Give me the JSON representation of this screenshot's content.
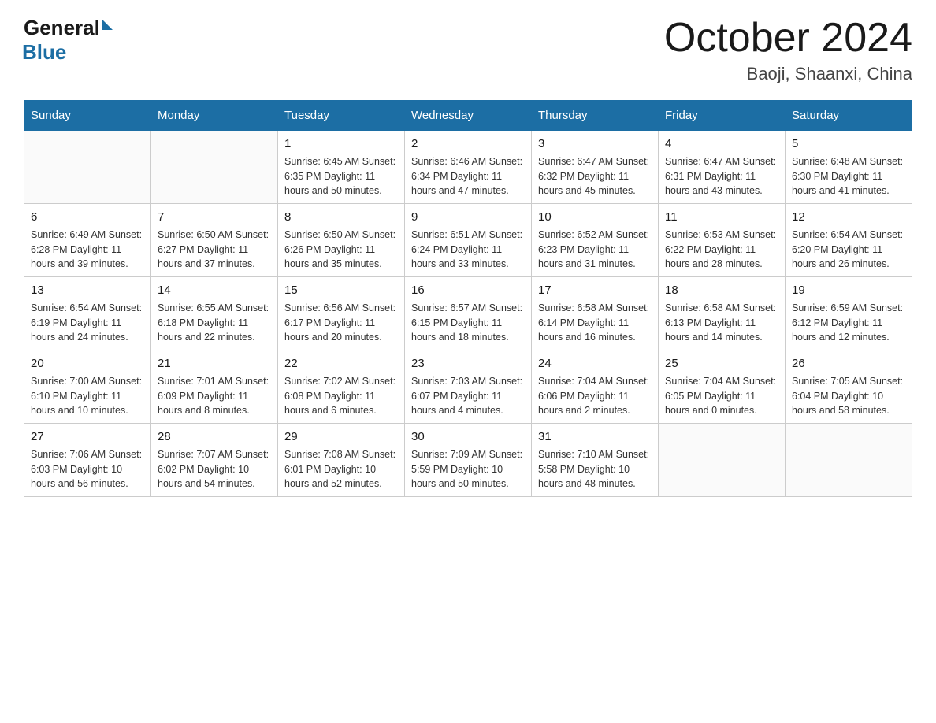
{
  "logo": {
    "general": "General",
    "blue": "Blue"
  },
  "title": "October 2024",
  "location": "Baoji, Shaanxi, China",
  "days_of_week": [
    "Sunday",
    "Monday",
    "Tuesday",
    "Wednesday",
    "Thursday",
    "Friday",
    "Saturday"
  ],
  "weeks": [
    [
      {
        "day": "",
        "info": ""
      },
      {
        "day": "",
        "info": ""
      },
      {
        "day": "1",
        "info": "Sunrise: 6:45 AM\nSunset: 6:35 PM\nDaylight: 11 hours\nand 50 minutes."
      },
      {
        "day": "2",
        "info": "Sunrise: 6:46 AM\nSunset: 6:34 PM\nDaylight: 11 hours\nand 47 minutes."
      },
      {
        "day": "3",
        "info": "Sunrise: 6:47 AM\nSunset: 6:32 PM\nDaylight: 11 hours\nand 45 minutes."
      },
      {
        "day": "4",
        "info": "Sunrise: 6:47 AM\nSunset: 6:31 PM\nDaylight: 11 hours\nand 43 minutes."
      },
      {
        "day": "5",
        "info": "Sunrise: 6:48 AM\nSunset: 6:30 PM\nDaylight: 11 hours\nand 41 minutes."
      }
    ],
    [
      {
        "day": "6",
        "info": "Sunrise: 6:49 AM\nSunset: 6:28 PM\nDaylight: 11 hours\nand 39 minutes."
      },
      {
        "day": "7",
        "info": "Sunrise: 6:50 AM\nSunset: 6:27 PM\nDaylight: 11 hours\nand 37 minutes."
      },
      {
        "day": "8",
        "info": "Sunrise: 6:50 AM\nSunset: 6:26 PM\nDaylight: 11 hours\nand 35 minutes."
      },
      {
        "day": "9",
        "info": "Sunrise: 6:51 AM\nSunset: 6:24 PM\nDaylight: 11 hours\nand 33 minutes."
      },
      {
        "day": "10",
        "info": "Sunrise: 6:52 AM\nSunset: 6:23 PM\nDaylight: 11 hours\nand 31 minutes."
      },
      {
        "day": "11",
        "info": "Sunrise: 6:53 AM\nSunset: 6:22 PM\nDaylight: 11 hours\nand 28 minutes."
      },
      {
        "day": "12",
        "info": "Sunrise: 6:54 AM\nSunset: 6:20 PM\nDaylight: 11 hours\nand 26 minutes."
      }
    ],
    [
      {
        "day": "13",
        "info": "Sunrise: 6:54 AM\nSunset: 6:19 PM\nDaylight: 11 hours\nand 24 minutes."
      },
      {
        "day": "14",
        "info": "Sunrise: 6:55 AM\nSunset: 6:18 PM\nDaylight: 11 hours\nand 22 minutes."
      },
      {
        "day": "15",
        "info": "Sunrise: 6:56 AM\nSunset: 6:17 PM\nDaylight: 11 hours\nand 20 minutes."
      },
      {
        "day": "16",
        "info": "Sunrise: 6:57 AM\nSunset: 6:15 PM\nDaylight: 11 hours\nand 18 minutes."
      },
      {
        "day": "17",
        "info": "Sunrise: 6:58 AM\nSunset: 6:14 PM\nDaylight: 11 hours\nand 16 minutes."
      },
      {
        "day": "18",
        "info": "Sunrise: 6:58 AM\nSunset: 6:13 PM\nDaylight: 11 hours\nand 14 minutes."
      },
      {
        "day": "19",
        "info": "Sunrise: 6:59 AM\nSunset: 6:12 PM\nDaylight: 11 hours\nand 12 minutes."
      }
    ],
    [
      {
        "day": "20",
        "info": "Sunrise: 7:00 AM\nSunset: 6:10 PM\nDaylight: 11 hours\nand 10 minutes."
      },
      {
        "day": "21",
        "info": "Sunrise: 7:01 AM\nSunset: 6:09 PM\nDaylight: 11 hours\nand 8 minutes."
      },
      {
        "day": "22",
        "info": "Sunrise: 7:02 AM\nSunset: 6:08 PM\nDaylight: 11 hours\nand 6 minutes."
      },
      {
        "day": "23",
        "info": "Sunrise: 7:03 AM\nSunset: 6:07 PM\nDaylight: 11 hours\nand 4 minutes."
      },
      {
        "day": "24",
        "info": "Sunrise: 7:04 AM\nSunset: 6:06 PM\nDaylight: 11 hours\nand 2 minutes."
      },
      {
        "day": "25",
        "info": "Sunrise: 7:04 AM\nSunset: 6:05 PM\nDaylight: 11 hours\nand 0 minutes."
      },
      {
        "day": "26",
        "info": "Sunrise: 7:05 AM\nSunset: 6:04 PM\nDaylight: 10 hours\nand 58 minutes."
      }
    ],
    [
      {
        "day": "27",
        "info": "Sunrise: 7:06 AM\nSunset: 6:03 PM\nDaylight: 10 hours\nand 56 minutes."
      },
      {
        "day": "28",
        "info": "Sunrise: 7:07 AM\nSunset: 6:02 PM\nDaylight: 10 hours\nand 54 minutes."
      },
      {
        "day": "29",
        "info": "Sunrise: 7:08 AM\nSunset: 6:01 PM\nDaylight: 10 hours\nand 52 minutes."
      },
      {
        "day": "30",
        "info": "Sunrise: 7:09 AM\nSunset: 5:59 PM\nDaylight: 10 hours\nand 50 minutes."
      },
      {
        "day": "31",
        "info": "Sunrise: 7:10 AM\nSunset: 5:58 PM\nDaylight: 10 hours\nand 48 minutes."
      },
      {
        "day": "",
        "info": ""
      },
      {
        "day": "",
        "info": ""
      }
    ]
  ]
}
